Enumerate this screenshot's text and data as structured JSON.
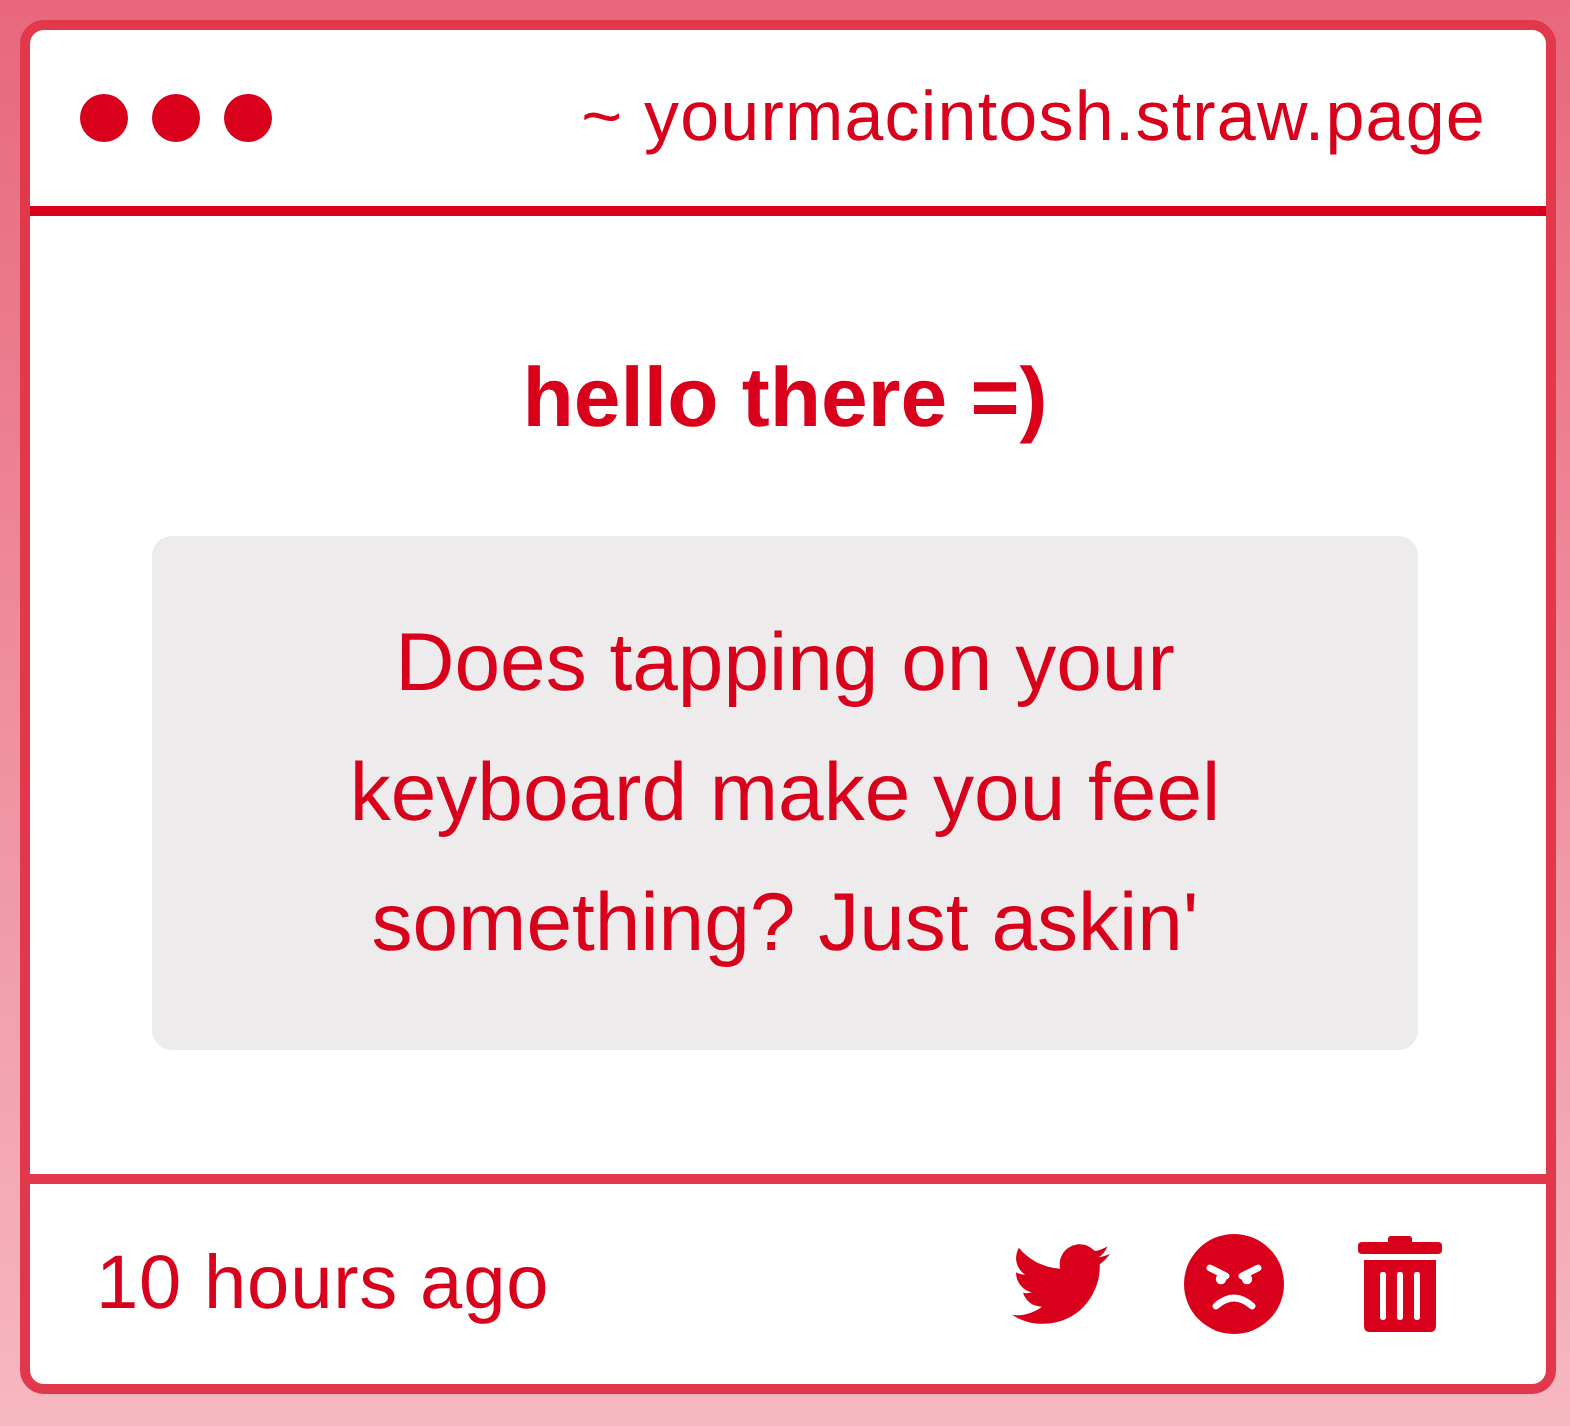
{
  "window": {
    "address": "~ yourmacintosh.straw.page"
  },
  "post": {
    "title": "hello there =)",
    "message": "Does tapping on your keyboard make you feel something? Just askin'"
  },
  "footer": {
    "timestamp": "10 hours ago",
    "actions": [
      {
        "kind": "share"
      },
      {
        "kind": "react"
      },
      {
        "kind": "delete"
      }
    ]
  }
}
